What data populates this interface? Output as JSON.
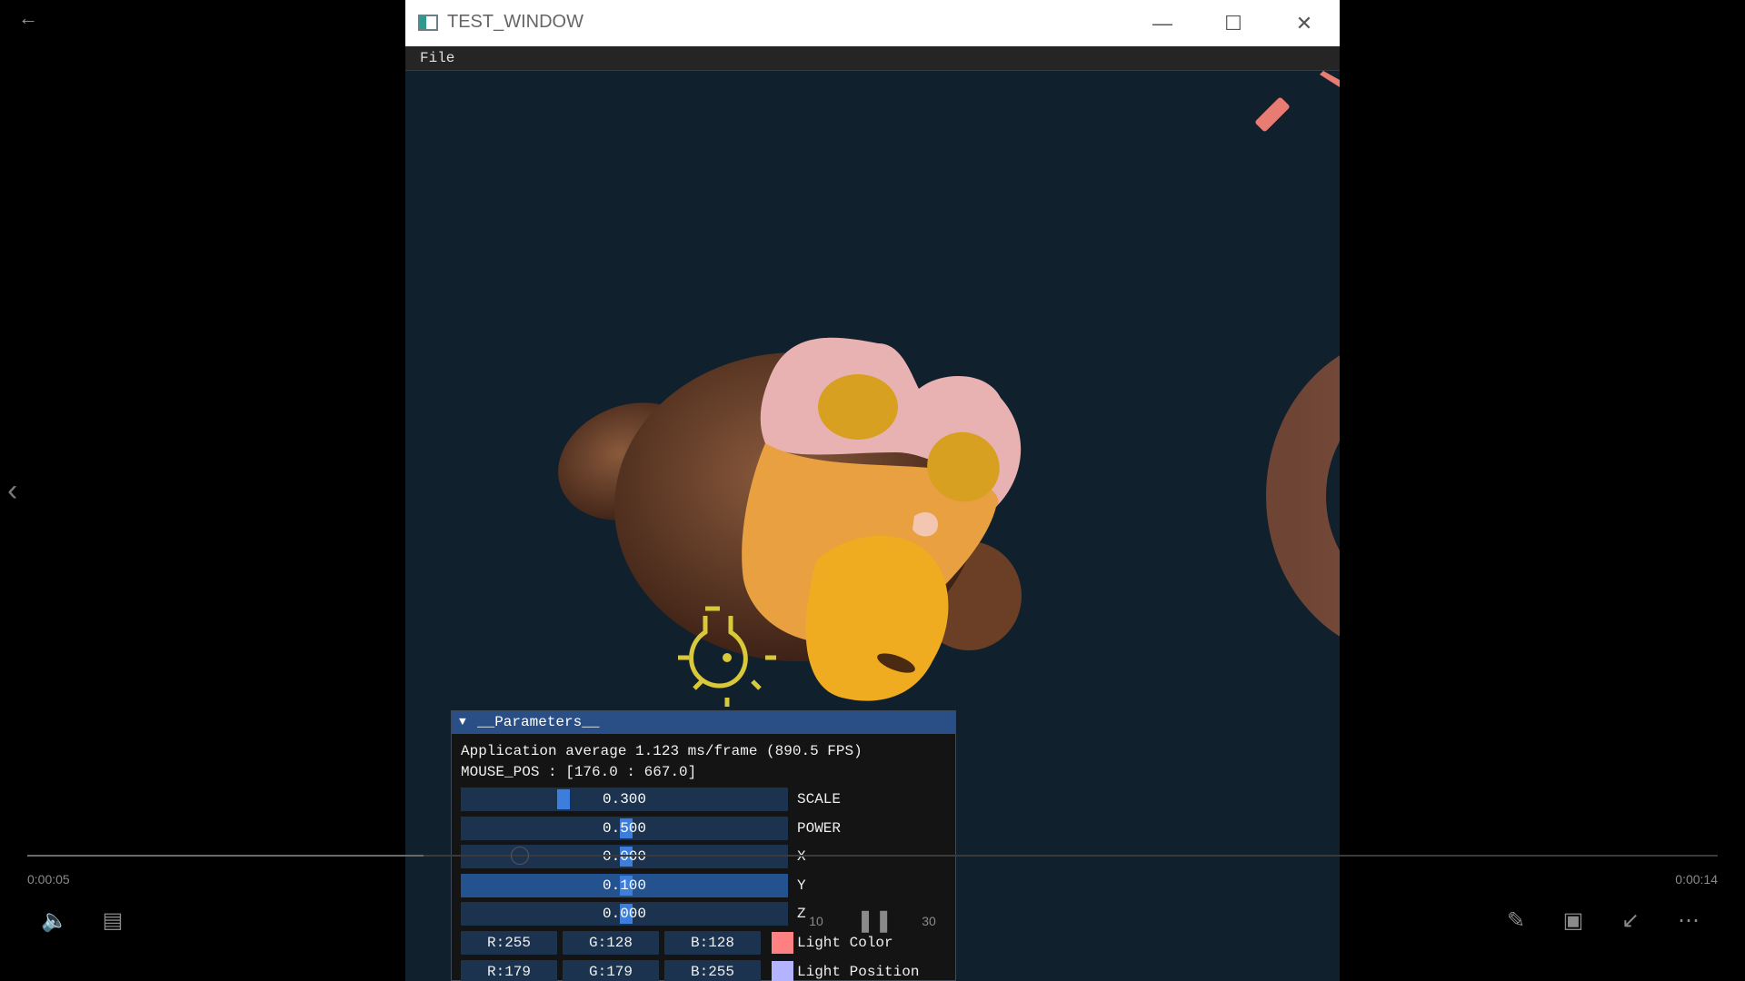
{
  "player": {
    "time_current": "0:00:05",
    "time_total": "0:00:14",
    "progress_fraction": 0.23,
    "skip_back_label": "10",
    "skip_forward_label": "30"
  },
  "window": {
    "title": "TEST_WINDOW",
    "menu": {
      "file": "File"
    }
  },
  "parameters": {
    "header": "__Parameters__",
    "app_average": "Application average 1.123 ms/frame (890.5 FPS)",
    "mouse_pos": "MOUSE_POS : [176.0 : 667.0]",
    "sliders": [
      {
        "value": "0.300",
        "label": "SCALE"
      },
      {
        "value": "0.500",
        "label": "POWER"
      },
      {
        "value": "0.000",
        "label": "X"
      },
      {
        "value": "0.100",
        "label": "Y"
      },
      {
        "value": "0.000",
        "label": "Z"
      }
    ],
    "light_color": {
      "r": "R:255",
      "g": "G:128",
      "b": "B:128",
      "label": "Light Color",
      "swatch": "#ff8080"
    },
    "light_position": {
      "r": "R:179",
      "g": "G:179",
      "b": "B:255",
      "label": "Light Position",
      "swatch": "#b3b3ff"
    }
  },
  "colors": {
    "viewport_bg": "#11202d",
    "panel_header": "#2a4f86",
    "slider_bg": "#1c3350",
    "slider_grab": "#3d7ddc",
    "light_icon": "#d8c83a"
  }
}
